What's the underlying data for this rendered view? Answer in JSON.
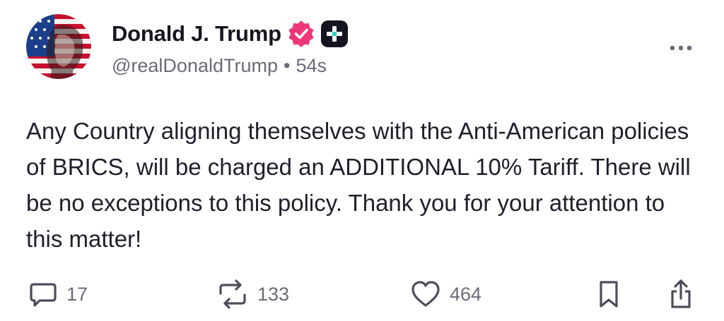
{
  "author": {
    "display_name": "Donald J. Trump",
    "handle": "@realDonaldTrump",
    "separator": "•",
    "timestamp": "54s",
    "verified": true,
    "verified_icon": "verified-badge-icon",
    "plus_icon": "plus-badge-icon",
    "verified_color": "#f0367a"
  },
  "post": {
    "text": "Any Country aligning themselves with the Anti-American policies of BRICS, will be charged an ADDITIONAL 10% Tariff. There will be no exceptions to this policy. Thank you for your attention to this matter!"
  },
  "actions": {
    "reply_count": "17",
    "retruth_count": "133",
    "like_count": "464",
    "reply_icon": "comment-icon",
    "retruth_icon": "repost-icon",
    "like_icon": "heart-icon",
    "bookmark_icon": "bookmark-icon",
    "share_icon": "share-icon",
    "more_icon": "more-options-icon"
  },
  "colors": {
    "text": "#1f1f2b",
    "secondary": "#6b6b78",
    "icon": "#4d4d5a"
  }
}
